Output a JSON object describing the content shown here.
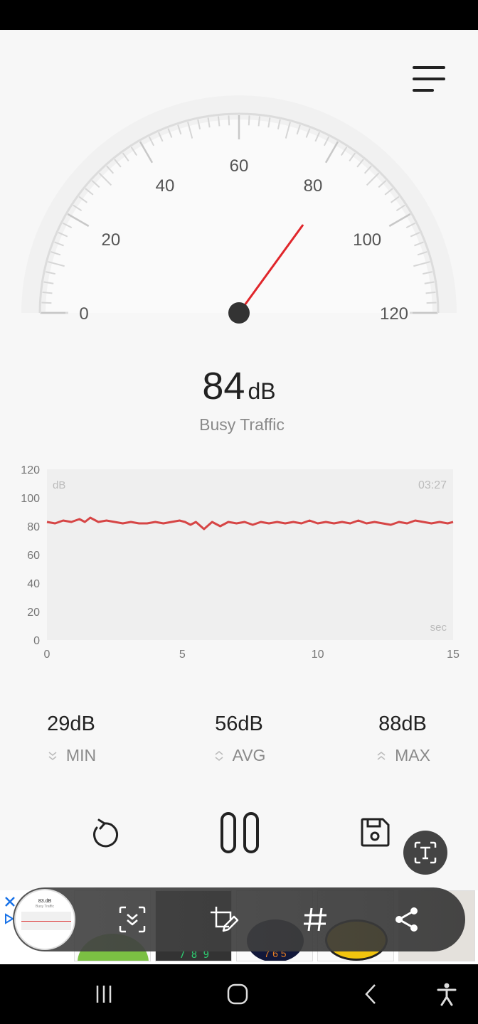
{
  "meter": {
    "value": "84",
    "unit": "dB",
    "category": "Busy Traffic",
    "gauge_min": 0,
    "gauge_max": 120,
    "gauge_labels": [
      "0",
      "20",
      "40",
      "60",
      "80",
      "100",
      "120"
    ],
    "needle_value": 84
  },
  "chart_data": {
    "type": "line",
    "title": "",
    "ylabel": "dB",
    "xlabel": "sec",
    "timestamp": "03:27",
    "ylim": [
      0,
      120
    ],
    "xlim": [
      0,
      15
    ],
    "yticks": [
      "0",
      "20",
      "40",
      "60",
      "80",
      "100",
      "120"
    ],
    "xticks": [
      "0",
      "5",
      "10",
      "15"
    ],
    "grid": false,
    "series": [
      {
        "color": "#d64545",
        "x": [
          0,
          0.3,
          0.6,
          0.9,
          1.2,
          1.4,
          1.6,
          1.9,
          2.2,
          2.5,
          2.8,
          3.1,
          3.4,
          3.7,
          4.0,
          4.3,
          4.6,
          4.9,
          5.1,
          5.3,
          5.5,
          5.8,
          6.1,
          6.4,
          6.7,
          7.0,
          7.3,
          7.6,
          7.9,
          8.2,
          8.5,
          8.8,
          9.1,
          9.4,
          9.7,
          10.0,
          10.3,
          10.6,
          10.9,
          11.2,
          11.5,
          11.8,
          12.1,
          12.4,
          12.7,
          13.0,
          13.3,
          13.6,
          13.9,
          14.2,
          14.5,
          14.8,
          15.0
        ],
        "y": [
          83,
          82,
          84,
          83,
          85,
          83,
          86,
          83,
          84,
          83,
          82,
          83,
          82,
          82,
          83,
          82,
          83,
          84,
          83,
          81,
          83,
          78,
          83,
          80,
          83,
          82,
          83,
          81,
          83,
          82,
          83,
          82,
          83,
          82,
          84,
          82,
          83,
          82,
          83,
          82,
          84,
          82,
          83,
          82,
          81,
          83,
          82,
          84,
          83,
          82,
          83,
          82,
          83
        ]
      }
    ]
  },
  "stats": {
    "min": {
      "value": "29dB",
      "label": "MIN"
    },
    "avg": {
      "value": "56dB",
      "label": "AVG"
    },
    "max": {
      "value": "88dB",
      "label": "MAX"
    }
  },
  "thumbnail": {
    "value": "83.dB",
    "category": "Busy Traffic"
  },
  "ad": {
    "digits": [
      "7",
      "8",
      "9"
    ],
    "digits2": [
      "7",
      "6",
      "5"
    ]
  },
  "colors": {
    "needle": "#e0262b",
    "line": "#d64545",
    "accent_ad": "#1a73e8"
  }
}
